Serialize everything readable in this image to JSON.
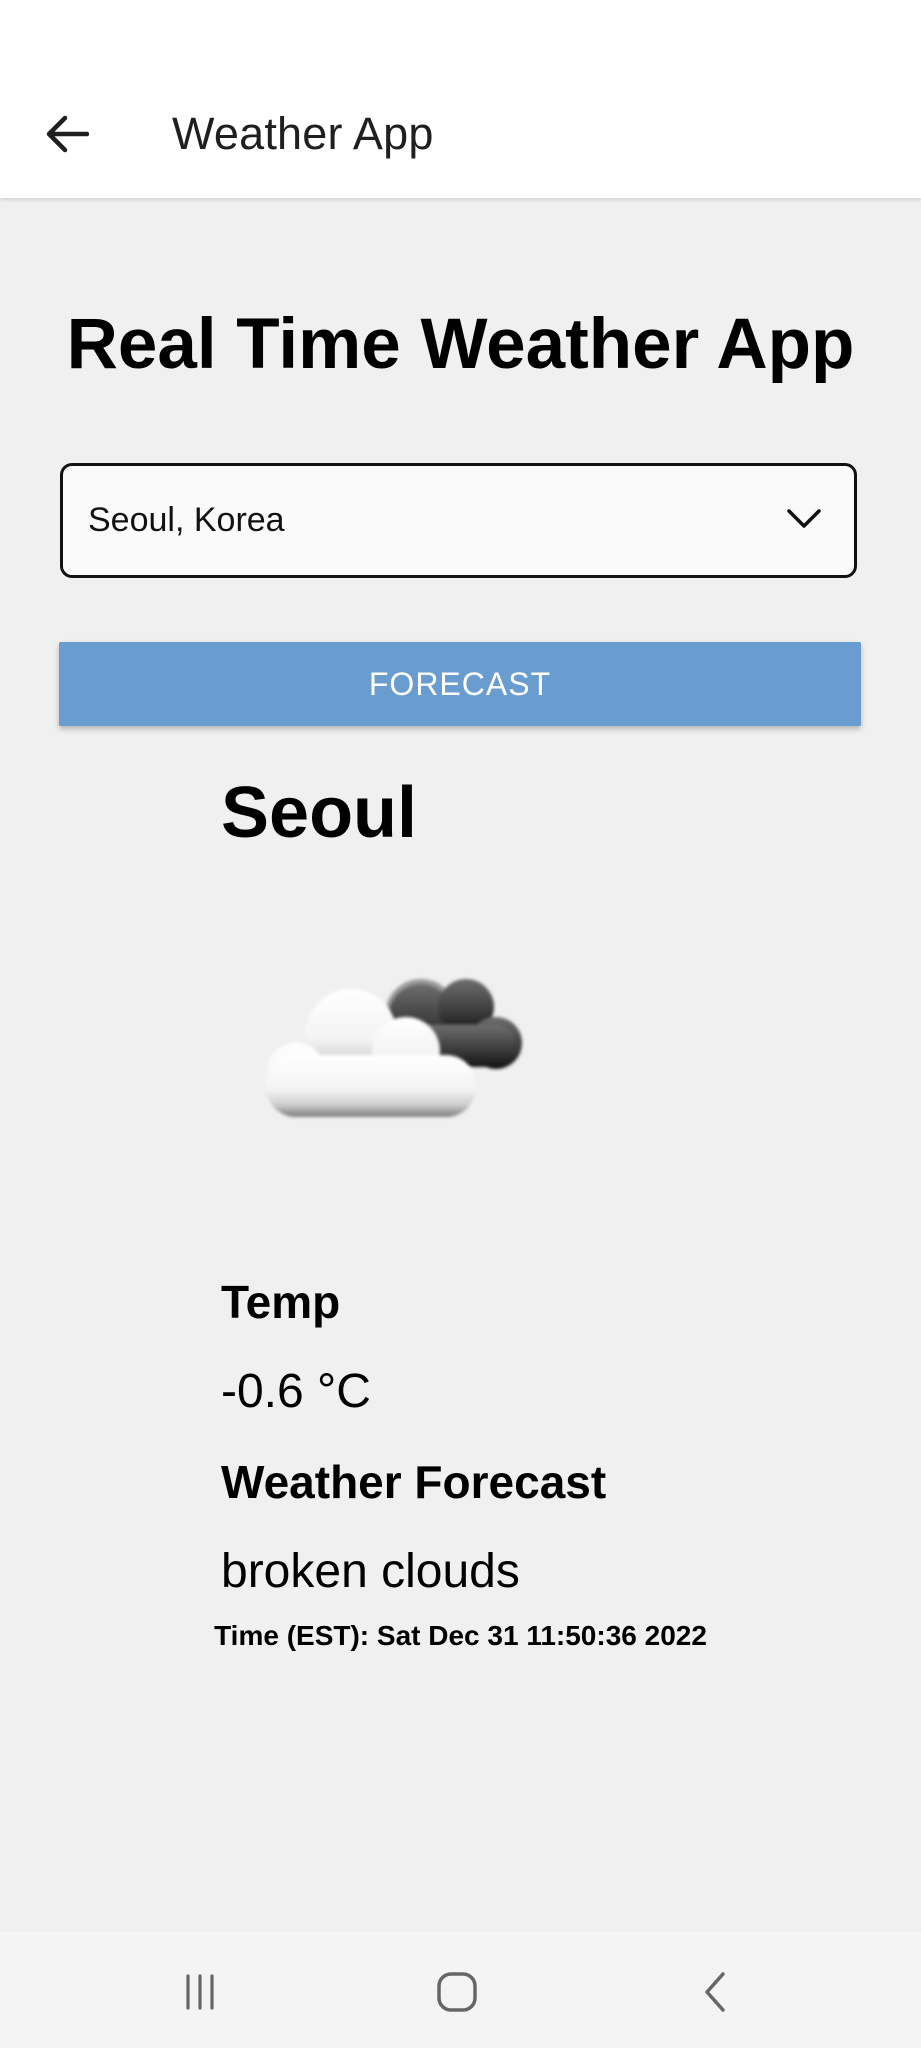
{
  "app_bar": {
    "title": "Weather App",
    "back_icon": "arrow-left-icon"
  },
  "main": {
    "heading": "Real Time Weather App",
    "city_select": {
      "selected": "Seoul, Korea",
      "icon": "chevron-down-icon"
    },
    "forecast_button": "FORECAST"
  },
  "result": {
    "city": "Seoul",
    "icon": "broken-clouds-icon",
    "temp_label": "Temp",
    "temp_value": "-0.6 °C",
    "forecast_label": "Weather Forecast",
    "forecast_value": "broken clouds",
    "time": "Time (EST): Sat Dec 31 11:50:36 2022"
  },
  "nav_bar": {
    "recents_icon": "recent-apps-icon",
    "home_icon": "home-icon",
    "back_icon": "back-chevron-icon"
  },
  "colors": {
    "background": "#f0f0f0",
    "app_bar": "#ffffff",
    "button": "#699ccf",
    "button_text": "#ffffff"
  }
}
